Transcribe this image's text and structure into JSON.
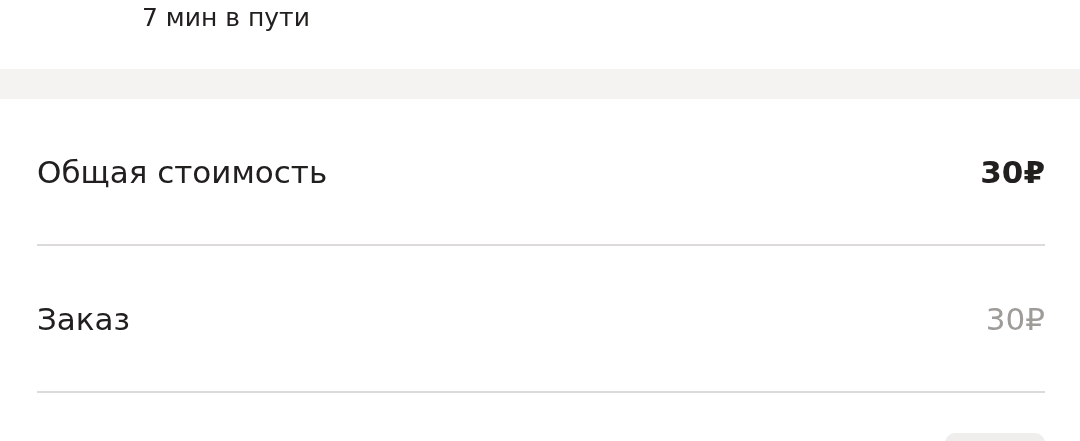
{
  "trip_time": "7 мин в пути",
  "rows": [
    {
      "kind": "total",
      "label": "Общая стоимость",
      "value": "30₽"
    },
    {
      "kind": "item",
      "label": "Заказ",
      "value": "30₽"
    }
  ]
}
